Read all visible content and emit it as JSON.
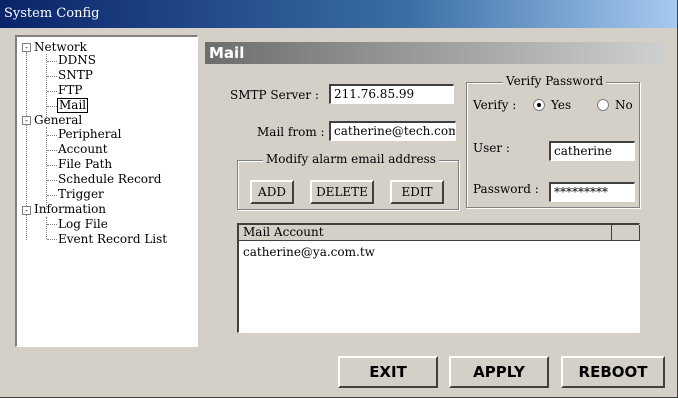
{
  "window": {
    "title": "System Config"
  },
  "tree": {
    "network": "Network",
    "ddns": "DDNS",
    "sntp": "SNTP",
    "ftp": "FTP",
    "mail": "Mail",
    "general": "General",
    "peripheral": "Peripheral",
    "account": "Account",
    "file_path": "File Path",
    "schedule_record": "Schedule Record",
    "trigger": "Trigger",
    "information": "Information",
    "log_file": "Log File",
    "event_record_list": "Event Record List",
    "expander_symbol": "-",
    "selected": "Mail"
  },
  "panel": {
    "header": "Mail"
  },
  "form": {
    "smtp_label": "SMTP Server :",
    "smtp_value": "211.76.85.99",
    "mail_from_label": "Mail from :",
    "mail_from_value": "catherine@tech.com"
  },
  "modify_group": {
    "title": "Modify alarm email address",
    "add": "ADD",
    "delete": "DELETE",
    "edit": "EDIT"
  },
  "verify_group": {
    "title": "Verify Password",
    "verify_label": "Verify :",
    "yes": "Yes",
    "no": "No",
    "selected": "Yes",
    "user_label": "User :",
    "user_value": "catherine",
    "password_label": "Password :",
    "password_value": "*********"
  },
  "mail_list": {
    "column": "Mail Account",
    "rows": [
      "catherine@ya.com.tw"
    ]
  },
  "footer": {
    "exit": "EXIT",
    "apply": "APPLY",
    "reboot": "REBOOT"
  },
  "colors": {
    "title_bar": "#0a246a",
    "header_bar": "#6d6d6d",
    "face": "#d4d0c8"
  }
}
